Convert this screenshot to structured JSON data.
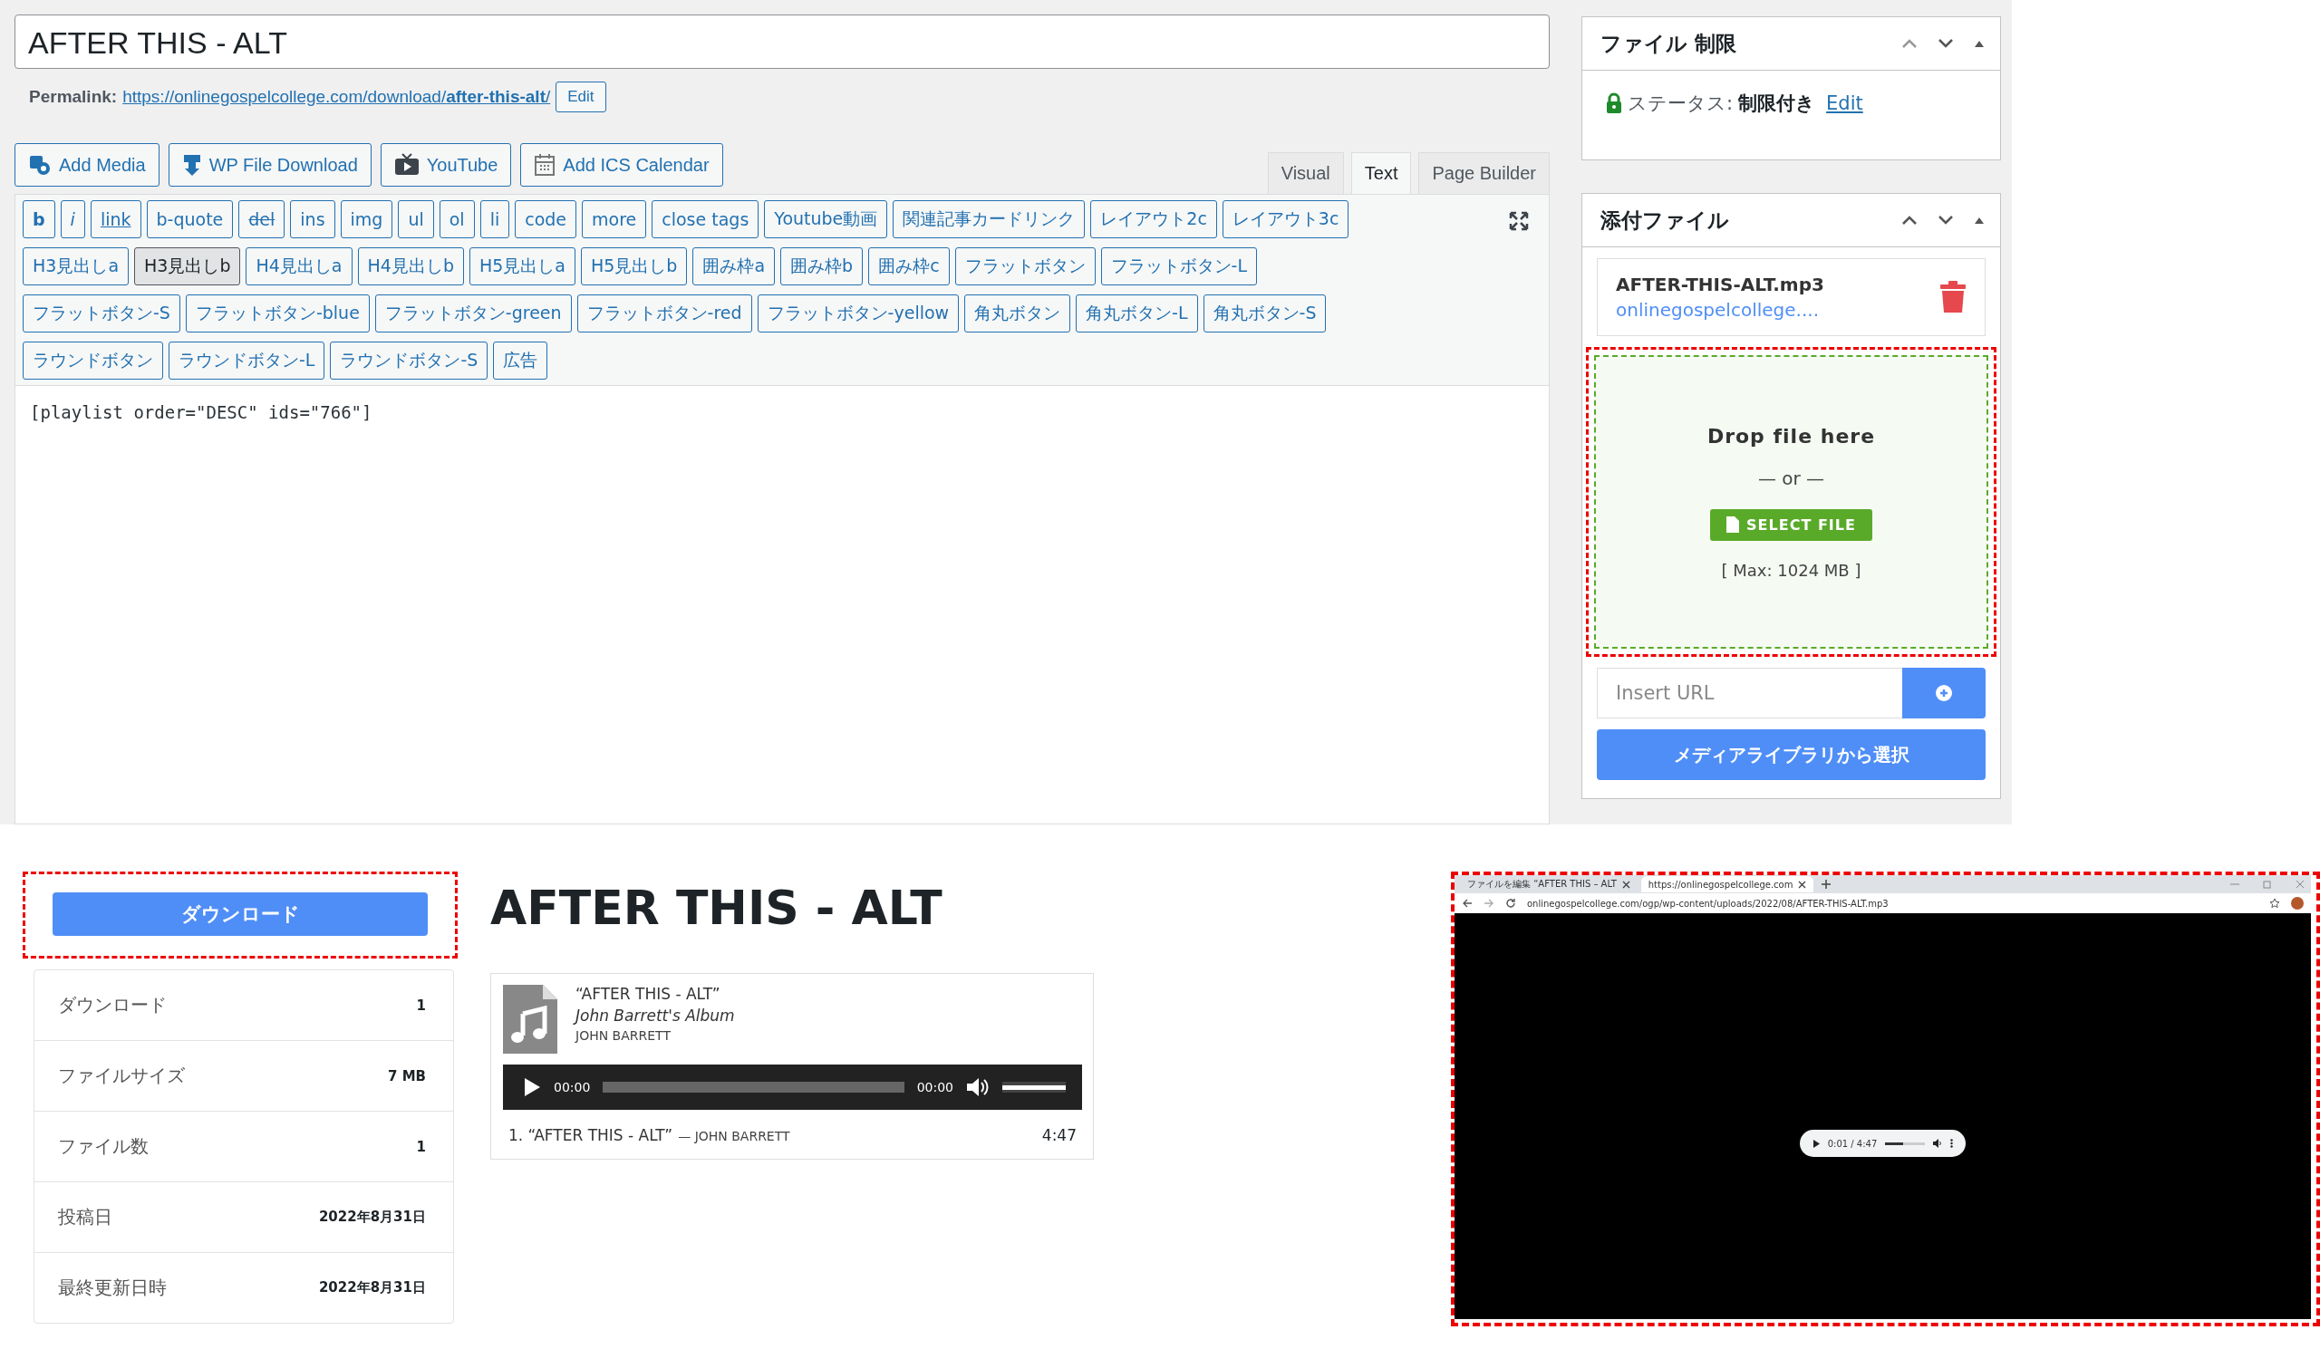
{
  "editor": {
    "title": "AFTER THIS - ALT",
    "permalink": {
      "label": "Permalink:",
      "url_base": "https://onlinegospelcollege.com/download/",
      "slug": "after-this-alt",
      "trail": "/",
      "edit": "Edit"
    },
    "media_buttons": [
      {
        "kind": "media",
        "label": "Add Media"
      },
      {
        "kind": "download",
        "label": "WP File Download"
      },
      {
        "kind": "video",
        "label": "YouTube"
      },
      {
        "kind": "calendar",
        "label": "Add ICS Calendar"
      }
    ],
    "tabs": [
      {
        "label": "Visual",
        "selected": false
      },
      {
        "label": "Text",
        "selected": true
      },
      {
        "label": "Page Builder",
        "selected": false
      }
    ],
    "quicktags": [
      [
        {
          "label": "b",
          "kind": "bold",
          "pressed": false
        },
        {
          "label": "i",
          "kind": "italic",
          "pressed": false
        },
        {
          "label": "link",
          "kind": "link",
          "pressed": false
        },
        {
          "label": "b-quote",
          "kind": "plain",
          "pressed": false
        },
        {
          "label": "del",
          "kind": "strike",
          "pressed": false
        },
        {
          "label": "ins",
          "kind": "plain",
          "pressed": false
        },
        {
          "label": "img",
          "kind": "plain",
          "pressed": false
        },
        {
          "label": "ul",
          "kind": "plain",
          "pressed": false
        },
        {
          "label": "ol",
          "kind": "plain",
          "pressed": false
        },
        {
          "label": "li",
          "kind": "plain",
          "pressed": false
        },
        {
          "label": "code",
          "kind": "plain",
          "pressed": false
        },
        {
          "label": "more",
          "kind": "plain",
          "pressed": false
        },
        {
          "label": "close tags",
          "kind": "plain",
          "pressed": false
        },
        {
          "label": "Youtube動画",
          "kind": "plain",
          "pressed": false
        },
        {
          "label": "関連記事カードリンク",
          "kind": "plain",
          "pressed": false
        },
        {
          "label": "レイアウト2c",
          "kind": "plain",
          "pressed": false
        },
        {
          "label": "レイアウト3c",
          "kind": "plain",
          "pressed": false
        }
      ],
      [
        {
          "label": "H3見出しa",
          "kind": "plain",
          "pressed": false
        },
        {
          "label": "H3見出しb",
          "kind": "plain",
          "pressed": true
        },
        {
          "label": "H4見出しa",
          "kind": "plain",
          "pressed": false
        },
        {
          "label": "H4見出しb",
          "kind": "plain",
          "pressed": false
        },
        {
          "label": "H5見出しa",
          "kind": "plain",
          "pressed": false
        },
        {
          "label": "H5見出しb",
          "kind": "plain",
          "pressed": false
        },
        {
          "label": "囲み枠a",
          "kind": "plain",
          "pressed": false
        },
        {
          "label": "囲み枠b",
          "kind": "plain",
          "pressed": false
        },
        {
          "label": "囲み枠c",
          "kind": "plain",
          "pressed": false
        },
        {
          "label": "フラットボタン",
          "kind": "plain",
          "pressed": false
        },
        {
          "label": "フラットボタン-L",
          "kind": "plain",
          "pressed": false
        }
      ],
      [
        {
          "label": "フラットボタン-S",
          "kind": "plain",
          "pressed": false
        },
        {
          "label": "フラットボタン-blue",
          "kind": "plain",
          "pressed": false
        },
        {
          "label": "フラットボタン-green",
          "kind": "plain",
          "pressed": false
        },
        {
          "label": "フラットボタン-red",
          "kind": "plain",
          "pressed": false
        },
        {
          "label": "フラットボタン-yellow",
          "kind": "plain",
          "pressed": false
        },
        {
          "label": "角丸ボタン",
          "kind": "plain",
          "pressed": false
        },
        {
          "label": "角丸ボタン-L",
          "kind": "plain",
          "pressed": false
        },
        {
          "label": "角丸ボタン-S",
          "kind": "plain",
          "pressed": false
        }
      ],
      [
        {
          "label": "ラウンドボタン",
          "kind": "plain",
          "pressed": false
        },
        {
          "label": "ラウンドボタン-L",
          "kind": "plain",
          "pressed": false
        },
        {
          "label": "ラウンドボタン-S",
          "kind": "plain",
          "pressed": false
        },
        {
          "label": "広告",
          "kind": "plain",
          "pressed": false
        }
      ]
    ],
    "content": "[playlist order=\"DESC\" ids=\"766\"]"
  },
  "sidebar": {
    "restriction": {
      "title": "ファイル 制限",
      "status_label": "ステータス:",
      "status_value": "制限付き",
      "edit": "Edit"
    },
    "attachment": {
      "title": "添付ファイル",
      "file_name": "AFTER-THIS-ALT.mp3",
      "file_link": "onlinegospelcollege....",
      "dropzone": {
        "highlighted": true,
        "heading": "Drop file here",
        "or": "— or —",
        "button": "SELECT FILE",
        "max": "[ Max: 1024 MB ]"
      },
      "url_placeholder": "Insert URL",
      "library_button": "メディアライブラリから選択"
    }
  },
  "download_page": {
    "download_button": {
      "label": "ダウンロード",
      "highlighted": true
    },
    "stats": [
      {
        "label": "ダウンロード",
        "value": "1"
      },
      {
        "label": "ファイルサイズ",
        "value": "7 MB"
      },
      {
        "label": "ファイル数",
        "value": "1"
      },
      {
        "label": "投稿日",
        "value": "2022年8月31日"
      },
      {
        "label": "最終更新日時",
        "value": "2022年8月31日"
      }
    ],
    "title": "AFTER THIS - ALT",
    "player": {
      "track_title": "“AFTER THIS - ALT”",
      "album": "John Barrett's Album",
      "artist": "JOHN BARRETT",
      "current_time": "00:00",
      "duration": "00:00",
      "volume": {
        "level": 1
      },
      "tracks": [
        {
          "title": "1. “AFTER THIS - ALT”",
          "artist": "— JOHN BARRETT",
          "length": "4:47"
        }
      ]
    }
  },
  "browser": {
    "highlighted": true,
    "tabs": [
      {
        "label": "ファイルを編集 “AFTER THIS – ALT",
        "selected": false
      },
      {
        "label": "https://onlinegospelcollege.com",
        "selected": true
      }
    ],
    "address": "onlinegospelcollege.com/ogp/wp-content/uploads/2022/08/AFTER-THIS-ALT.mp3",
    "audio": {
      "time": "0:01 / 4:47",
      "progress": {
        "level": 0.45
      }
    }
  }
}
